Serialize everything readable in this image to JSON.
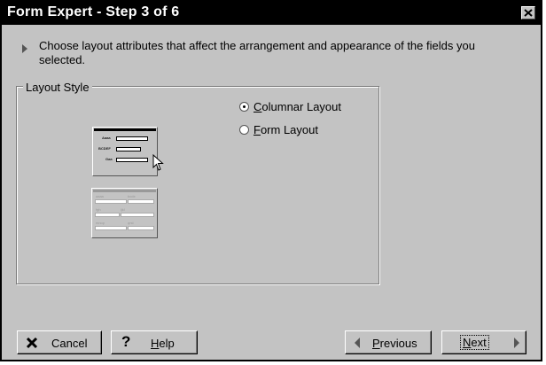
{
  "window": {
    "title": "Form Expert - Step 3 of 6"
  },
  "instructions": "Choose layout attributes that affect the arrangement and appearance of the fields you selected.",
  "layout_style": {
    "group_label": "Layout Style",
    "options": [
      {
        "label": "Columnar Layout",
        "mnemonic": "C",
        "rest": "olumnar Layout",
        "selected": true
      },
      {
        "label": "Form Layout",
        "mnemonic": "F",
        "rest": "orm Layout",
        "selected": false
      }
    ]
  },
  "buttons": {
    "cancel": {
      "label": "Cancel"
    },
    "help": {
      "mnemonic": "H",
      "rest": "elp"
    },
    "previous": {
      "mnemonic": "P",
      "rest": "revious"
    },
    "next": {
      "mnemonic": "N",
      "rest": "ext"
    }
  },
  "icons": {
    "instruction": "triangle-right-icon",
    "cancel": "x-icon",
    "help": "question-mark-icon",
    "previous": "arrow-left-icon",
    "next": "arrow-right-icon",
    "close": "close-icon"
  }
}
